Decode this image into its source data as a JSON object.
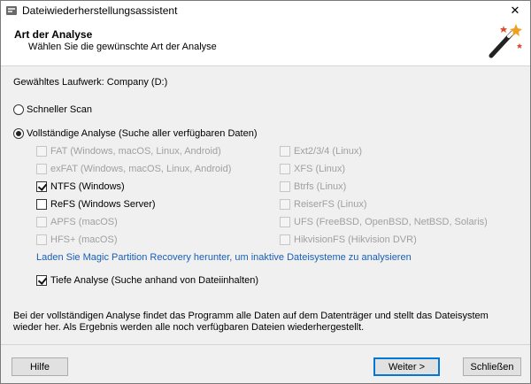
{
  "window": {
    "title": "Dateiwiederherstellungsassistent",
    "close_glyph": "✕"
  },
  "header": {
    "title": "Art der Analyse",
    "subtitle": "Wählen Sie die gewünschte Art der Analyse",
    "icon": "magic-wand-icon"
  },
  "drive": {
    "label": "Gewähltes Laufwerk: Company (D:)"
  },
  "scan_options": {
    "quick": {
      "label": "Schneller Scan",
      "checked": false
    },
    "full": {
      "label": "Vollständige Analyse (Suche aller verfügbaren Daten)",
      "checked": true
    }
  },
  "filesystems_left": [
    {
      "label": "FAT (Windows, macOS, Linux, Android)",
      "checked": false,
      "enabled": false
    },
    {
      "label": "exFAT (Windows, macOS, Linux, Android)",
      "checked": false,
      "enabled": false
    },
    {
      "label": "NTFS (Windows)",
      "checked": true,
      "enabled": true
    },
    {
      "label": "ReFS (Windows Server)",
      "checked": false,
      "enabled": true
    },
    {
      "label": "APFS (macOS)",
      "checked": false,
      "enabled": false
    },
    {
      "label": "HFS+ (macOS)",
      "checked": false,
      "enabled": false
    }
  ],
  "filesystems_right": [
    {
      "label": "Ext2/3/4 (Linux)",
      "checked": false,
      "enabled": false
    },
    {
      "label": "XFS (Linux)",
      "checked": false,
      "enabled": false
    },
    {
      "label": "Btrfs (Linux)",
      "checked": false,
      "enabled": false
    },
    {
      "label": "ReiserFS (Linux)",
      "checked": false,
      "enabled": false
    },
    {
      "label": "UFS (FreeBSD, OpenBSD, NetBSD, Solaris)",
      "checked": false,
      "enabled": false
    },
    {
      "label": "HikvisionFS (Hikvision DVR)",
      "checked": false,
      "enabled": false
    }
  ],
  "download_link": "Laden Sie Magic Partition Recovery herunter, um inaktive Dateisysteme zu analysieren",
  "deep_analysis": {
    "label": "Tiefe Analyse (Suche anhand von Dateiinhalten)",
    "checked": true
  },
  "info_text": "Bei der vollständigen Analyse findet das Programm alle Daten auf dem Datenträger und stellt das Dateisystem wieder her. Als Ergebnis werden alle noch verfügbaren Dateien wiederhergestellt.",
  "buttons": {
    "help": "Hilfe",
    "next": "Weiter >",
    "close": "Schließen"
  },
  "colors": {
    "link": "#1a5fb4",
    "default_button_border": "#0078d7",
    "disabled_text": "#a0a0a0"
  }
}
